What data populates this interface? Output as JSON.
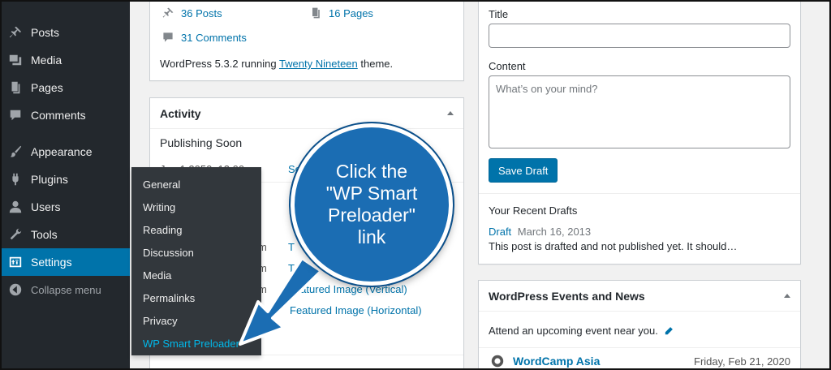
{
  "sidebar": {
    "items": [
      {
        "label": "Posts",
        "icon": "pin-icon"
      },
      {
        "label": "Media",
        "icon": "media-icon"
      },
      {
        "label": "Pages",
        "icon": "pages-icon"
      },
      {
        "label": "Comments",
        "icon": "comment-icon"
      },
      {
        "label": "Appearance",
        "icon": "brush-icon"
      },
      {
        "label": "Plugins",
        "icon": "plug-icon"
      },
      {
        "label": "Users",
        "icon": "user-icon"
      },
      {
        "label": "Tools",
        "icon": "wrench-icon"
      },
      {
        "label": "Settings",
        "icon": "settings-icon",
        "active": true
      }
    ],
    "collapse_label": "Collapse menu"
  },
  "settings_submenu": [
    "General",
    "Writing",
    "Reading",
    "Discussion",
    "Media",
    "Permalinks",
    "Privacy",
    "WP Smart Preloader"
  ],
  "at_a_glance": {
    "posts": "36 Posts",
    "pages": "16 Pages",
    "comments": "31 Comments",
    "version_prefix": "WordPress 5.3.2 running ",
    "theme": "Twenty Nineteen",
    "version_suffix": " theme."
  },
  "activity": {
    "title": "Activity",
    "publishing_soon": "Publishing Soon",
    "partial_row_date": "Jan 1 2050, 12:00 am",
    "partial_row_link": "So",
    "partial_dates": [
      "m",
      "m",
      "m"
    ],
    "partial_links": [
      "T",
      "T"
    ],
    "featured_vertical": "Featured Image (Vertical)",
    "featured_horizontal": "Featured Image (Horizontal)"
  },
  "quick_draft": {
    "title_label": "Title",
    "content_label": "Content",
    "content_placeholder": "What’s on your mind?",
    "save_button": "Save Draft",
    "recent_drafts_heading": "Your Recent Drafts",
    "draft_link": "Draft",
    "draft_date": "March 16, 2013",
    "draft_excerpt": "This post is drafted and not published yet. It should…"
  },
  "events": {
    "title": "WordPress Events and News",
    "attend_text": "Attend an upcoming event near you.",
    "event_name": "WordCamp Asia",
    "event_date": "Friday, Feb 21, 2020"
  },
  "callout": {
    "lines": [
      "Click the",
      "\"WP Smart",
      "Preloader\"",
      "link"
    ]
  },
  "colors": {
    "sidebar_bg": "#23282d",
    "flyout_bg": "#32373c",
    "active_blue": "#0073aa",
    "submenu_highlight": "#00b9eb",
    "callout_blue": "#1b6db3"
  }
}
